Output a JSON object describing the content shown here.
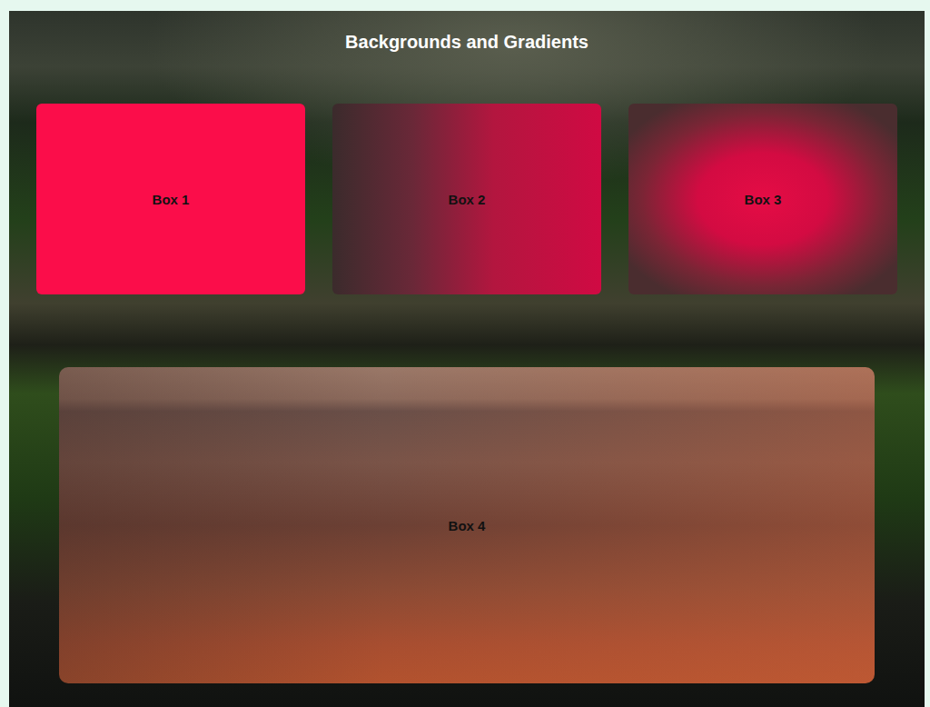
{
  "page": {
    "title": "Backgrounds and Gradients"
  },
  "boxes": [
    {
      "label": "Box 1",
      "kind": "solid"
    },
    {
      "label": "Box 2",
      "kind": "linear"
    },
    {
      "label": "Box 3",
      "kind": "radial"
    }
  ],
  "feature_box": {
    "label": "Box 4",
    "kind": "image"
  }
}
